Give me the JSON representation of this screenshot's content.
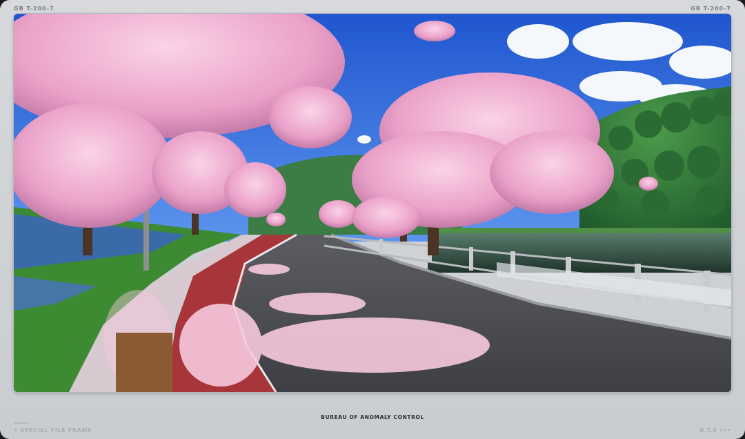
{
  "frame": {
    "top_left_code": "GB   T-200-7",
    "top_right_code": "GB   T-200-7",
    "caption": "BUREAU OF ANOMALY CONTROL",
    "footer_left": "• SPECIAL FILE FRAME",
    "footer_right": "N.T.S •••"
  },
  "image": {
    "subject": "cherry-blossom-lakeside-road",
    "colors": {
      "sky": "#2f66d8",
      "blossom": "#f2b6d6",
      "road": "#4a4b50",
      "bike_lane": "#a8353a",
      "water": "#2f4a3e",
      "hill": "#2f7a3a"
    }
  }
}
